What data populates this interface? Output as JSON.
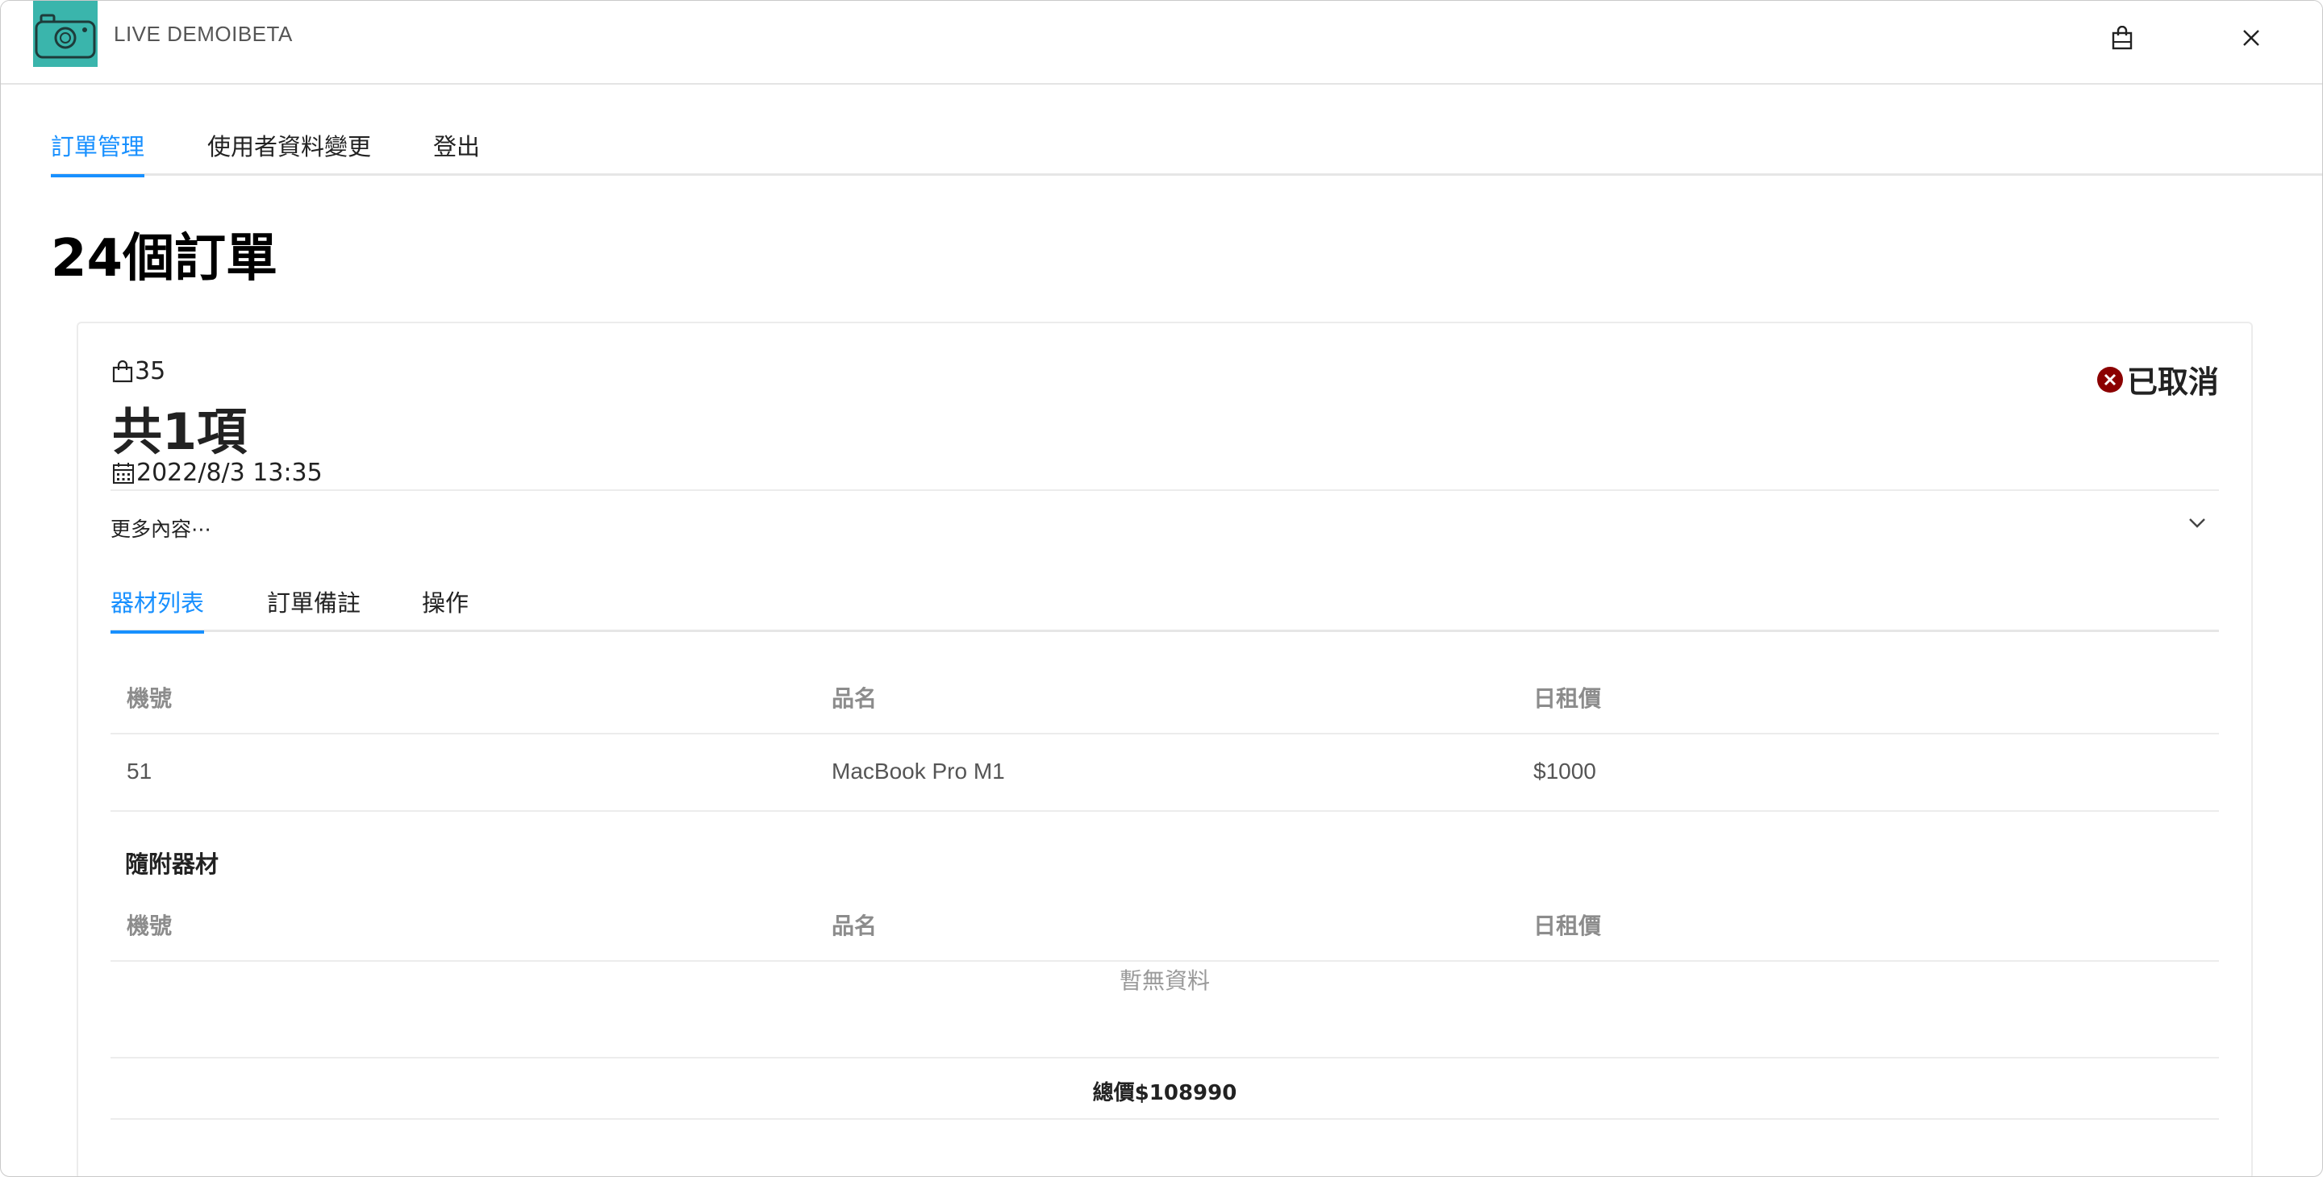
{
  "app": {
    "title": "LIVE DEMOIBETA"
  },
  "header_icons": [
    "shopping-bag-icon",
    "close-icon"
  ],
  "main_tabs": [
    {
      "label": "訂單管理",
      "active": true
    },
    {
      "label": "使用者資料變更",
      "active": false
    },
    {
      "label": "登出",
      "active": false
    }
  ],
  "order_count": "24個訂單",
  "order": {
    "id": "35",
    "item_count": "共1項",
    "date": "2022/8/3 13:35",
    "status": "已取消",
    "status_color": "#8b0000",
    "more_label": "更多內容⋯",
    "sub_tabs": [
      {
        "label": "器材列表",
        "active": true
      },
      {
        "label": "訂單備註",
        "active": false
      },
      {
        "label": "操作",
        "active": false
      }
    ],
    "equipment_table": {
      "headers": [
        "機號",
        "品名",
        "日租價"
      ],
      "rows": [
        [
          "51",
          "MacBook Pro M1",
          "$1000"
        ]
      ]
    },
    "accessories": {
      "title": "隨附器材",
      "headers": [
        "機號",
        "品名",
        "日租價"
      ],
      "empty_text": "暫無資料"
    },
    "total": "總價$108990"
  },
  "colors": {
    "accent": "#1890ff",
    "logo_bg": "#3ab5ac"
  }
}
